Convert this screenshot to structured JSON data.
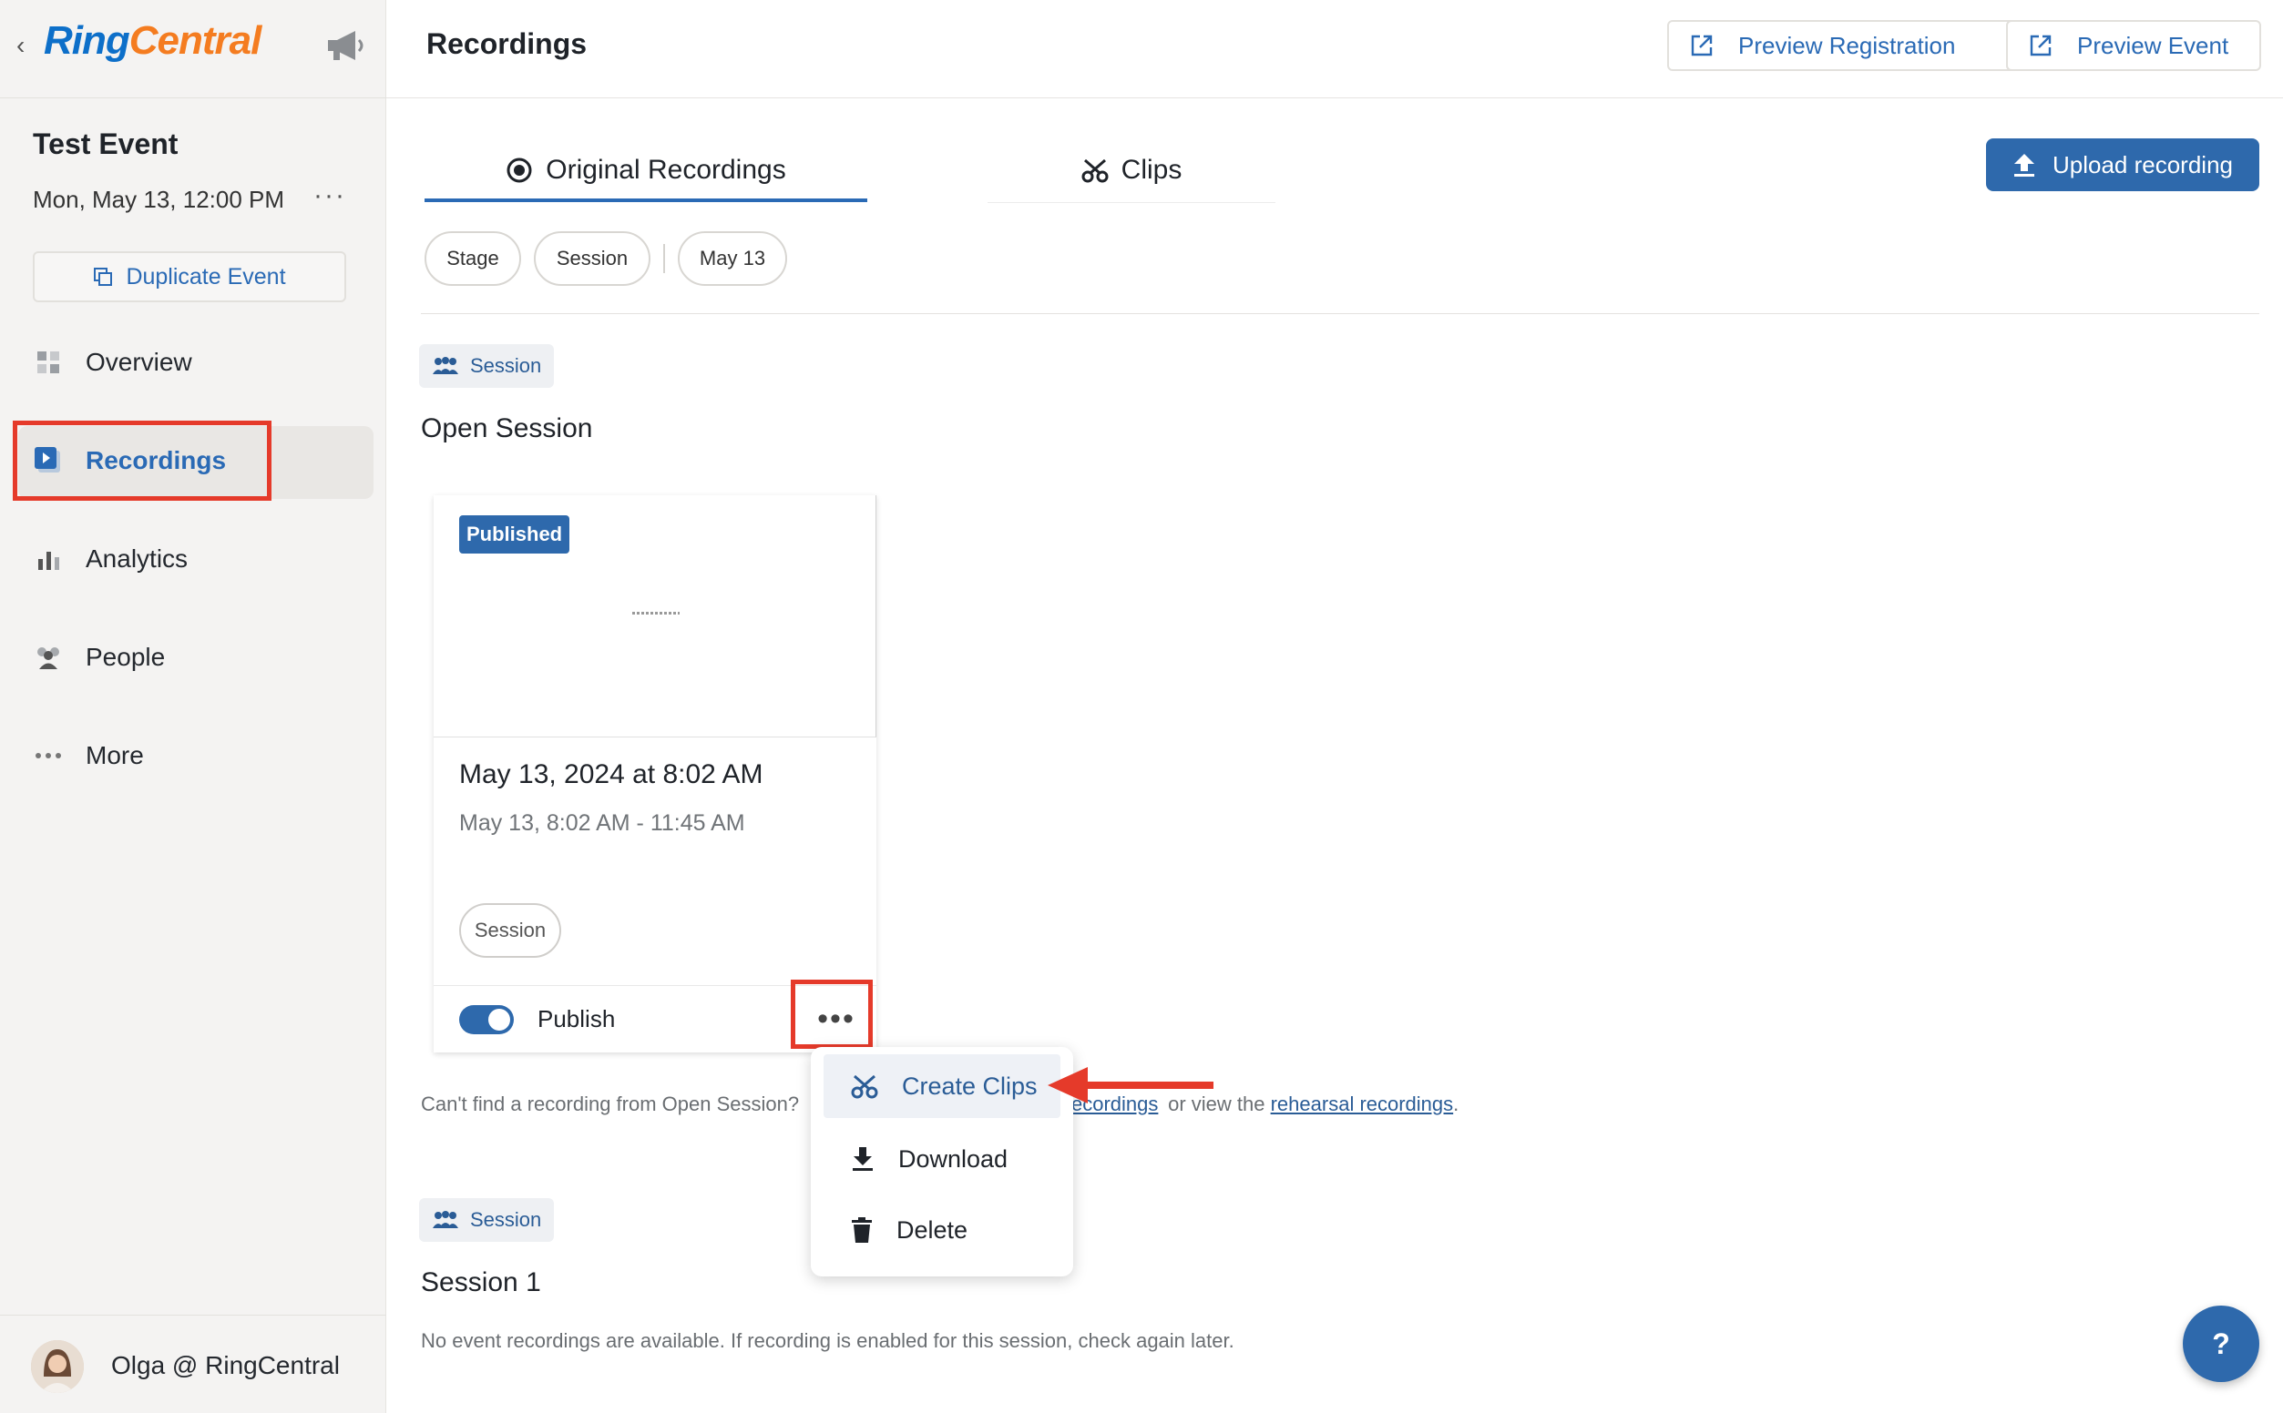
{
  "sidebar": {
    "logo_ring": "Ring",
    "logo_central": "Central",
    "event_title": "Test Event",
    "event_date": "Mon, May 13, 12:00 PM",
    "event_more": "···",
    "duplicate_label": "Duplicate Event",
    "nav": [
      {
        "label": "Overview",
        "icon": "grid-icon"
      },
      {
        "label": "Recordings",
        "icon": "recordings-icon",
        "active": true
      },
      {
        "label": "Analytics",
        "icon": "bar-chart-icon"
      },
      {
        "label": "People",
        "icon": "people-icon"
      },
      {
        "label": "More",
        "icon": "dots-icon"
      }
    ],
    "user_name": "Olga @ RingCentral"
  },
  "header": {
    "title": "Recordings",
    "preview_registration": "Preview Registration",
    "preview_event": "Preview Event"
  },
  "tabs": [
    {
      "label": "Original Recordings",
      "active": true
    },
    {
      "label": "Clips"
    }
  ],
  "upload_label": "Upload recording",
  "filters": [
    "Stage",
    "Session",
    "May 13"
  ],
  "sections": [
    {
      "tag": "Session",
      "title": "Open Session",
      "card": {
        "badge": "Published",
        "date": "May 13, 2024 at 8:02 AM",
        "time_range": "May 13, 8:02 AM - 11:45 AM",
        "chip": "Session",
        "publish_label": "Publish",
        "more": "•••"
      },
      "help_prefix": "Can't find a recording from Open Session?",
      "help_link_1": "ecordings",
      "help_middle": " or view the ",
      "help_link_2": "rehearsal recordings",
      "help_suffix": "."
    },
    {
      "tag": "Session",
      "title": "Session 1",
      "empty_text": "No event recordings are available. If recording is enabled for this session, check again later."
    }
  ],
  "menu": [
    {
      "label": "Create Clips",
      "icon": "scissors-icon",
      "highlighted": true
    },
    {
      "label": "Download",
      "icon": "download-icon"
    },
    {
      "label": "Delete",
      "icon": "trash-icon"
    }
  ],
  "help_fab": "?",
  "colors": {
    "accent": "#2e69ac",
    "annotation_red": "#e53a2a",
    "logo_blue": "#0d6fc9",
    "logo_orange": "#f47c20"
  }
}
